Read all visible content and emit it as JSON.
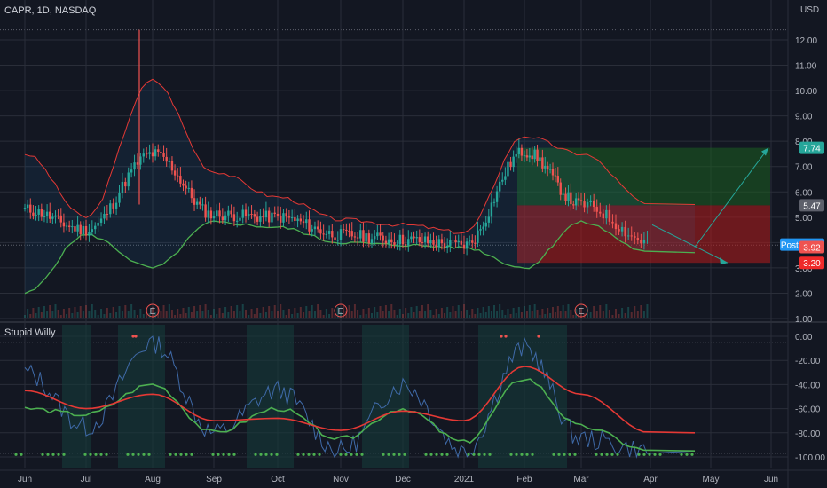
{
  "header": {
    "symbol_line": "CAPR, 1D, NASDAQ",
    "currency": "USD"
  },
  "indicator": {
    "name": "Stupid Willy"
  },
  "earnings_marker": "E",
  "colors": {
    "background": "#131722",
    "grid": "#2a2e39",
    "up": "#26a69a",
    "down": "#ef5350",
    "upper_band": "#e53935",
    "lower_band": "#4caf50",
    "long_target_zone": "#1b5e20",
    "long_stop_zone": "#b71c1c",
    "willy_line": "#3f6aa8",
    "fast_ma": "#4caf50",
    "slow_ma": "#e53935",
    "highlight_band": "#163a3a"
  },
  "price_tags": [
    {
      "label": "7.74",
      "value": 7.74,
      "color": "#26a69a"
    },
    {
      "label": "5.47",
      "value": 5.47,
      "color": "#5d606b"
    },
    {
      "label": "Post · 3.92",
      "value": 3.92,
      "color": "#2196f3"
    },
    {
      "label": "3.92",
      "value": 3.82,
      "color": "#ef5350"
    },
    {
      "label": "3.20",
      "value": 3.2,
      "color": "#ef2a2a"
    }
  ],
  "chart_data": [
    {
      "type": "candlestick",
      "title": "CAPR, 1D, NASDAQ",
      "ylabel": "USD",
      "ylim": [
        1.0,
        13.0
      ],
      "yticks": [
        1.0,
        2.0,
        3.0,
        4.0,
        5.0,
        6.0,
        7.0,
        8.0,
        9.0,
        10.0,
        11.0,
        12.0
      ],
      "ytick_labels": [
        "1.00",
        "2.00",
        "3.00",
        "4.00",
        "5.00",
        "6.00",
        "7.00",
        "8.00",
        "9.00",
        "10.00",
        "11.00",
        "12.00"
      ],
      "x_labels": [
        "Jun",
        "Jul",
        "Aug",
        "Sep",
        "Oct",
        "Nov",
        "Dec",
        "2021",
        "Feb",
        "Mar",
        "Apr",
        "May",
        "Jun"
      ],
      "close_path": [
        [
          "Jun",
          5.3
        ],
        [
          "Jul",
          4.5
        ],
        [
          "Aug",
          7.5
        ],
        [
          "Sep",
          5.1
        ],
        [
          "Oct",
          5.0
        ],
        [
          "Nov",
          4.3
        ],
        [
          "Dec",
          4.1
        ],
        [
          "2021",
          3.9
        ],
        [
          "Feb",
          7.6
        ],
        [
          "Mar",
          5.5
        ],
        [
          "Apr",
          4.0
        ]
      ],
      "upper_band_path": [
        [
          "Jun",
          7.5
        ],
        [
          "Jul",
          5.0
        ],
        [
          "Aug",
          10.4
        ],
        [
          "Sep",
          6.8
        ],
        [
          "Oct",
          5.8
        ],
        [
          "Nov",
          4.9
        ],
        [
          "Dec",
          4.7
        ],
        [
          "2021",
          4.4
        ],
        [
          "Feb",
          8.2
        ],
        [
          "Mar",
          7.5
        ],
        [
          "Apr",
          5.5
        ]
      ],
      "lower_band_path": [
        [
          "Jun",
          2.0
        ],
        [
          "Jul",
          4.3
        ],
        [
          "Aug",
          3.0
        ],
        [
          "Sep",
          4.8
        ],
        [
          "Oct",
          4.6
        ],
        [
          "Nov",
          4.0
        ],
        [
          "Dec",
          3.9
        ],
        [
          "2021",
          3.8
        ],
        [
          "Feb",
          3.0
        ],
        [
          "Mar",
          4.8
        ],
        [
          "Apr",
          3.6
        ]
      ],
      "earnings_events": [
        "Aug",
        "Nov",
        "Mar"
      ],
      "positions": [
        {
          "kind": "long",
          "entry": 5.47,
          "target": 7.74,
          "stop": 3.2
        }
      ]
    },
    {
      "type": "line",
      "title": "Stupid Willy",
      "ylim": [
        -105,
        5
      ],
      "yticks": [
        0,
        -20,
        -40,
        -60,
        -80,
        -100
      ],
      "ytick_labels": [
        "0.00",
        "-20.00",
        "-40.00",
        "-60.00",
        "-80.00",
        "-100.00"
      ],
      "series": [
        {
          "values_by_month": [
            [
              "Jun",
              -30
            ],
            [
              "Jul",
              -75
            ],
            [
              "Aug",
              -5
            ],
            [
              "Sep",
              -80
            ],
            [
              "Oct",
              -45
            ],
            [
              "Nov",
              -95
            ],
            [
              "Dec",
              -40
            ],
            [
              "2021",
              -95
            ],
            [
              "Feb",
              -10
            ],
            [
              "Mar",
              -85
            ],
            [
              "Apr",
              -95
            ]
          ]
        },
        {
          "values_by_month": [
            [
              "Jun",
              -60
            ],
            [
              "Jul",
              -65
            ],
            [
              "Aug",
              -40
            ],
            [
              "Sep",
              -80
            ],
            [
              "Oct",
              -60
            ],
            [
              "Nov",
              -85
            ],
            [
              "Dec",
              -60
            ],
            [
              "2021",
              -88
            ],
            [
              "Feb",
              -35
            ],
            [
              "Mar",
              -75
            ],
            [
              "Apr",
              -95
            ]
          ]
        },
        {
          "values_by_month": [
            [
              "Jun",
              -45
            ],
            [
              "Jul",
              -60
            ],
            [
              "Aug",
              -48
            ],
            [
              "Sep",
              -70
            ],
            [
              "Oct",
              -68
            ],
            [
              "Nov",
              -78
            ],
            [
              "Dec",
              -62
            ],
            [
              "2021",
              -70
            ],
            [
              "Feb",
              -25
            ],
            [
              "Mar",
              -48
            ],
            [
              "Apr",
              -80
            ]
          ]
        }
      ]
    }
  ]
}
